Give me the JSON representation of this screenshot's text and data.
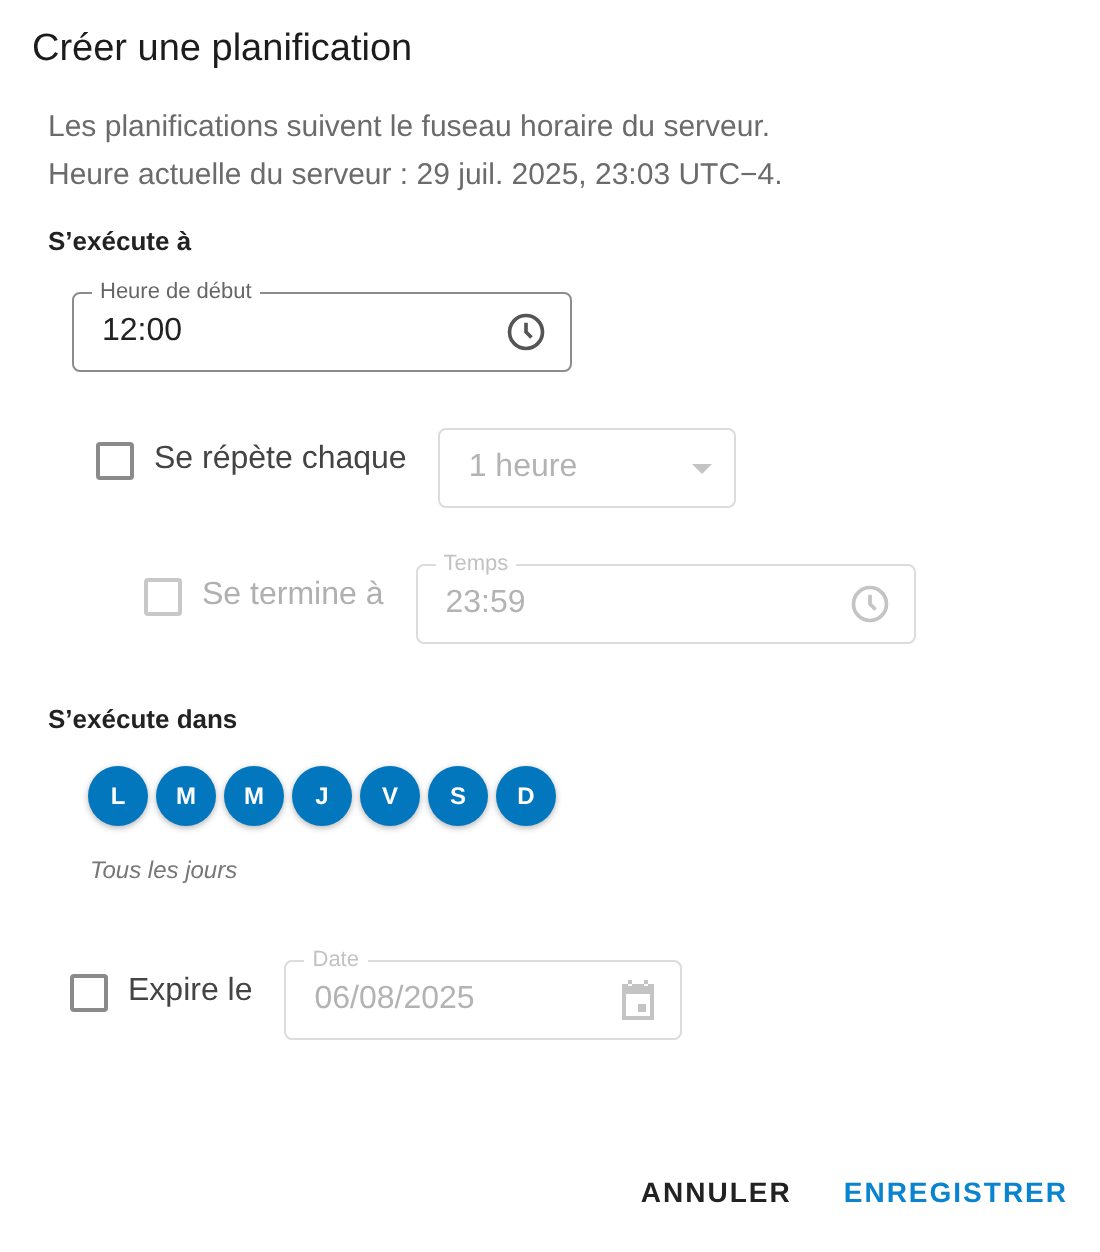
{
  "dialog": {
    "title": "Créer une planification"
  },
  "description": [
    "Les planifications suivent le fuseau horaire du serveur.",
    "Heure actuelle du serveur : 29 juil. 2025, 23:03 UTC−4."
  ],
  "runs_at": {
    "heading": "S’exécute à",
    "start_field": {
      "label": "Heure de début",
      "value": "12:00",
      "disabled": false
    }
  },
  "repeat": {
    "label": "Se répète chaque",
    "checked": false,
    "disabled": false,
    "select": {
      "value": "1 heure",
      "disabled": true
    }
  },
  "ends": {
    "label": "Se termine à",
    "checked": false,
    "disabled": true,
    "field": {
      "label": "Temps",
      "value": "23:59",
      "disabled": true
    }
  },
  "runs_on": {
    "heading": "S’exécute dans",
    "summary": "Tous les jours",
    "days": [
      {
        "label": "L",
        "selected": true
      },
      {
        "label": "M",
        "selected": true
      },
      {
        "label": "M",
        "selected": true
      },
      {
        "label": "J",
        "selected": true
      },
      {
        "label": "V",
        "selected": true
      },
      {
        "label": "S",
        "selected": true
      },
      {
        "label": "D",
        "selected": true
      }
    ]
  },
  "expires": {
    "label": "Expire le",
    "checked": false,
    "disabled": false,
    "field": {
      "label": "Date",
      "value": "06/08/2025",
      "disabled": true
    }
  },
  "buttons": [
    {
      "label": "ANNULER",
      "kind": "text"
    },
    {
      "label": "ENREGISTRER",
      "kind": "primary"
    }
  ]
}
